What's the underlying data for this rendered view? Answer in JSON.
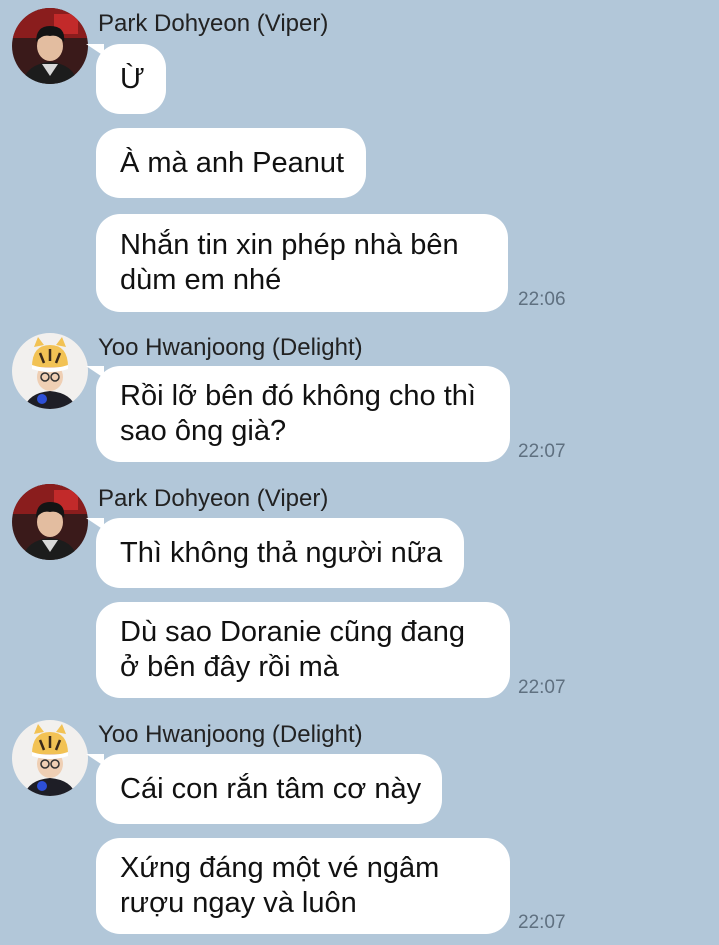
{
  "colors": {
    "background": "#b2c7d9",
    "bubble": "#ffffff",
    "timestamp": "#5f7080"
  },
  "groups": [
    {
      "sender": "Park Dohyeon (Viper)",
      "avatar_icon": "user-avatar-icon",
      "messages": [
        {
          "lines": [
            "Ừ"
          ]
        },
        {
          "lines": [
            "À mà anh Peanut"
          ]
        },
        {
          "lines": [
            "Nhắn tin xin phép nhà bên",
            "dùm em nhé"
          ],
          "time": "22:06"
        }
      ]
    },
    {
      "sender": "Yoo Hwanjoong (Delight)",
      "avatar_icon": "user-avatar-icon",
      "messages": [
        {
          "lines": [
            "Rồi lỡ bên đó không cho thì",
            "sao ông già?"
          ],
          "time": "22:07"
        }
      ]
    },
    {
      "sender": "Park Dohyeon (Viper)",
      "avatar_icon": "user-avatar-icon",
      "messages": [
        {
          "lines": [
            "Thì không thả người nữa"
          ]
        },
        {
          "lines": [
            "Dù sao Doranie cũng đang",
            "ở bên đây rồi mà"
          ],
          "time": "22:07"
        }
      ]
    },
    {
      "sender": "Yoo Hwanjoong (Delight)",
      "avatar_icon": "user-avatar-icon",
      "messages": [
        {
          "lines": [
            "Cái con rắn tâm cơ này"
          ]
        },
        {
          "lines": [
            "Xứng đáng một vé ngâm",
            "rượu ngay và luôn"
          ],
          "time": "22:07"
        }
      ]
    }
  ]
}
